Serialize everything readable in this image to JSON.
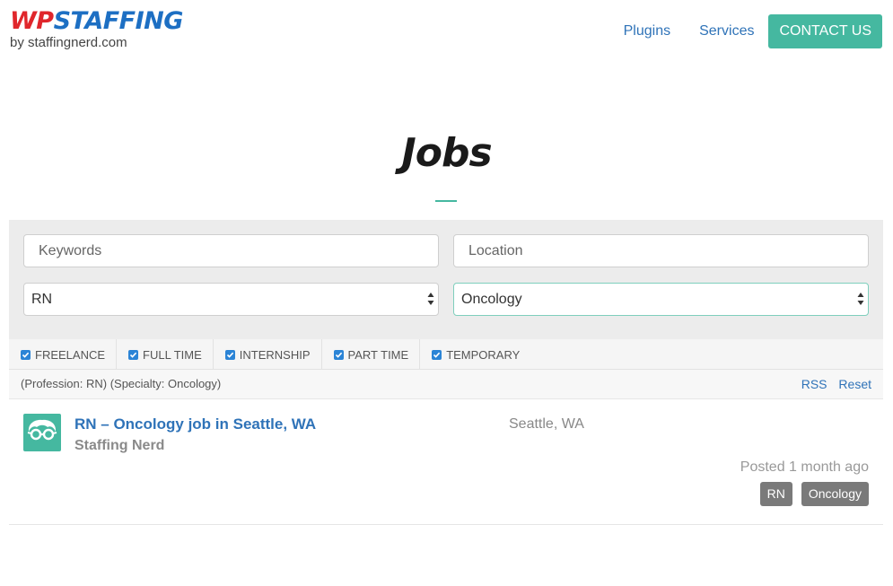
{
  "brand": {
    "logo_wp": "WP",
    "logo_staffing": "STAFFING",
    "logo_sub": "by staffingnerd.com",
    "colors": {
      "wp": "#e0262b",
      "staffing": "#1d6fc3",
      "accent": "#45b8a0",
      "link": "#2f73b8"
    }
  },
  "nav": {
    "plugins": "Plugins",
    "services": "Services",
    "contact": "CONTACT US"
  },
  "page": {
    "title": "Jobs"
  },
  "search": {
    "keywords_placeholder": "Keywords",
    "location_placeholder": "Location",
    "profession_value": "RN",
    "specialty_value": "Oncology"
  },
  "job_types": [
    {
      "label": "FREELANCE",
      "checked": true
    },
    {
      "label": "FULL TIME",
      "checked": true
    },
    {
      "label": "INTERNSHIP",
      "checked": true
    },
    {
      "label": "PART TIME",
      "checked": true
    },
    {
      "label": "TEMPORARY",
      "checked": true
    }
  ],
  "filter_summary": {
    "text": "(Profession: RN) (Specialty: Oncology)",
    "rss": "RSS",
    "reset": "Reset"
  },
  "jobs": [
    {
      "title": "RN – Oncology job in Seattle, WA",
      "company": "Staffing Nerd",
      "location": "Seattle, WA",
      "posted": "Posted 1 month ago",
      "tags": [
        "RN",
        "Oncology"
      ],
      "logo_icon": "nerd-glasses-icon"
    }
  ]
}
